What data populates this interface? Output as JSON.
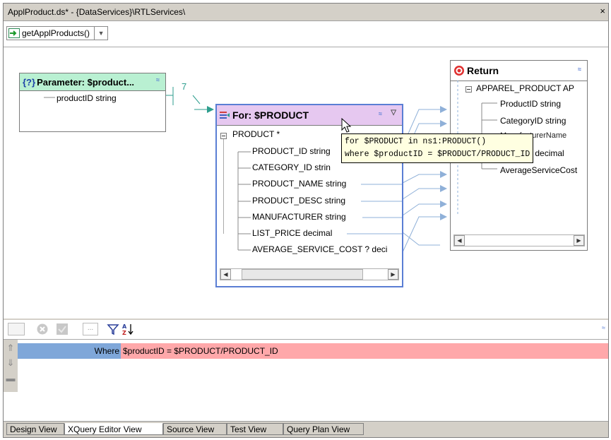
{
  "window": {
    "title": "ApplProduct.ds* - {DataServices}\\RTLServices\\",
    "close_label": "×"
  },
  "toolbar": {
    "function_name": "getApplProducts()"
  },
  "parameter_box": {
    "title": "Parameter: $product...",
    "icon_text": "{?}",
    "row": "productID  string",
    "connector_label": "7"
  },
  "for_box": {
    "title": "For: $PRODUCT",
    "root": "PRODUCT *",
    "rows": [
      "PRODUCT_ID  string",
      "CATEGORY_ID  strin",
      "PRODUCT_NAME  string",
      "PRODUCT_DESC  string",
      "MANUFACTURER  string",
      "LIST_PRICE  decimal",
      "AVERAGE_SERVICE_COST ?  deci"
    ]
  },
  "return_box": {
    "title": "Return",
    "root": "APPAREL_PRODUCT  AP",
    "rows": [
      "ProductID  string",
      "CategoryID  string",
      "ManufacturerName",
      "ListPrice  decimal",
      "AverageServiceCost"
    ]
  },
  "tooltip": {
    "line1": "for $PRODUCT in ns1:PRODUCT()",
    "line2": "where $productID = $PRODUCT/PRODUCT_ID"
  },
  "bottom_toolbar": {
    "ellipsis": "..."
  },
  "where_clause": {
    "label": "Where",
    "expression": "$productID = $PRODUCT/PRODUCT_ID"
  },
  "tabs": [
    "Design View",
    "XQuery Editor View",
    "Source View",
    "Test View",
    "Query Plan View"
  ],
  "colors": {
    "parameter_header": "#b9f0d2",
    "for_header": "#e6c8f0",
    "for_border": "#5a7ed4",
    "where_label_bg": "#7fa7d9",
    "where_expr_bg": "#ffa8aa",
    "tooltip_bg": "#ffffe1",
    "connector": "#8fb0d8"
  }
}
